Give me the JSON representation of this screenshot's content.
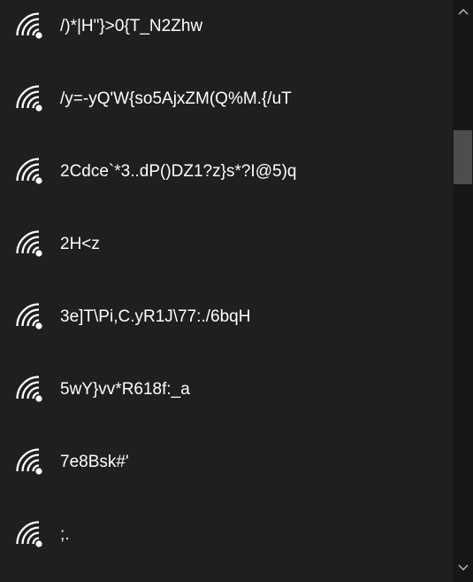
{
  "networks": [
    {
      "ssid": "/)*|H\"}>0{T_N2Zhw",
      "icon": "wifi-signal-icon"
    },
    {
      "ssid": "/y=-yQ'W{so5AjxZM(Q%M.{/uT",
      "icon": "wifi-signal-icon"
    },
    {
      "ssid": "2Cdce`*3..dP()DZ1?z}s*?I@5)q",
      "icon": "wifi-signal-icon"
    },
    {
      "ssid": "2H<z",
      "icon": "wifi-signal-icon"
    },
    {
      "ssid": "3e]T\\Pi,C.yR1J\\77:./6bqH",
      "icon": "wifi-signal-icon"
    },
    {
      "ssid": "5wY}vv*R618f:_a",
      "icon": "wifi-signal-icon"
    },
    {
      "ssid": "7e8Bsk#'",
      "icon": "wifi-signal-icon"
    },
    {
      "ssid": ";.",
      "icon": "wifi-signal-icon"
    }
  ],
  "scrollbar": {
    "up_icon": "chevron-up-icon",
    "down_icon": "chevron-down-icon"
  },
  "colors": {
    "background": "#1f1f1f",
    "text": "#ffffff",
    "scrollbar_track": "#171717",
    "scrollbar_thumb": "#4d4d4d"
  }
}
